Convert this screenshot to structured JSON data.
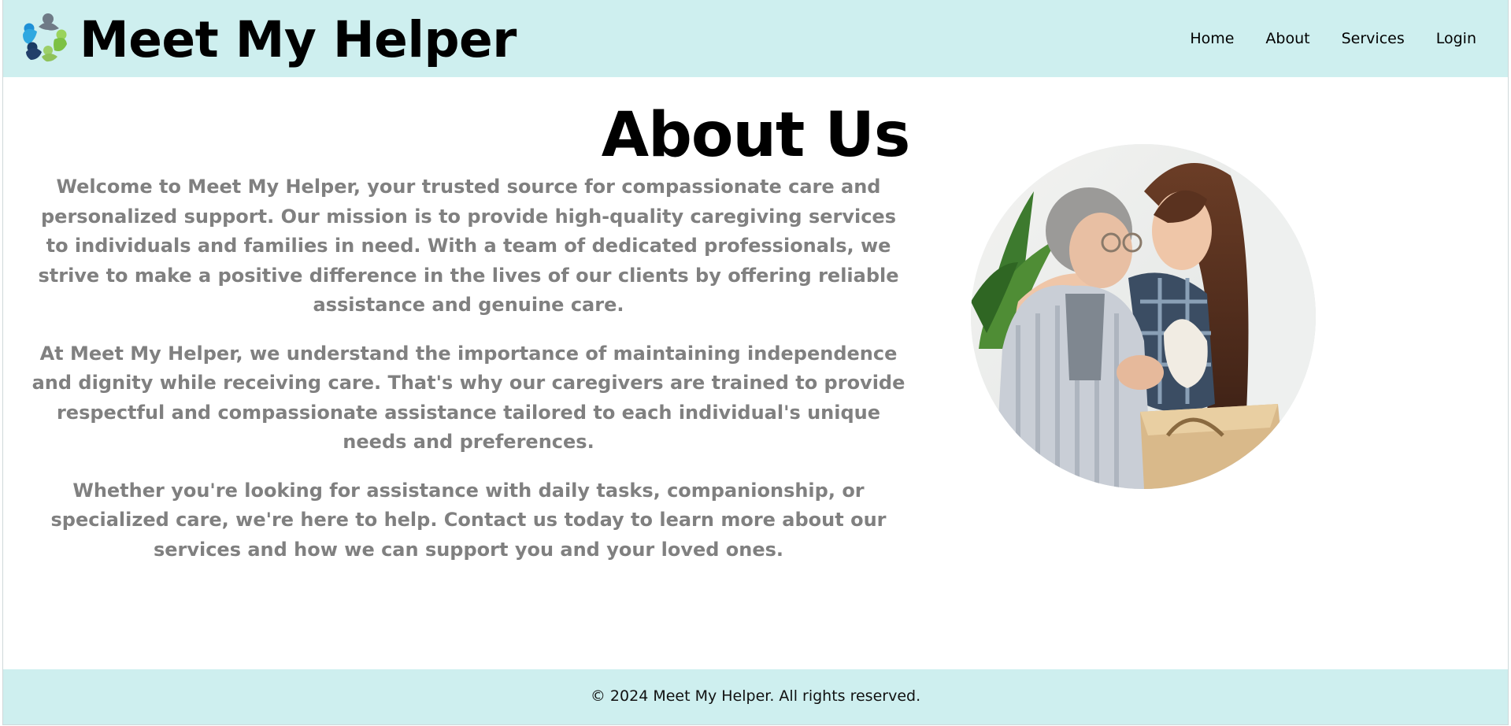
{
  "header": {
    "site_title": "Meet My Helper",
    "logo_icon": "people-circle-logo-icon",
    "background": "#ceefef",
    "nav": [
      {
        "label": "Home"
      },
      {
        "label": "About"
      },
      {
        "label": "Services"
      },
      {
        "label": "Login"
      }
    ]
  },
  "main": {
    "heading": "About Us",
    "text_color": "#808080",
    "paragraphs": [
      "Welcome to Meet My Helper, your trusted source for compassionate care and personalized support. Our mission is to provide high-quality caregiving services to individuals and families in need. With a team of dedicated professionals, we strive to make a positive difference in the lives of our clients by offering reliable assistance and genuine care.",
      "At Meet My Helper, we understand the importance of maintaining independence and dignity while receiving care. That's why our caregivers are trained to provide respectful and compassionate assistance tailored to each individual's unique needs and preferences.",
      "Whether you're looking for assistance with daily tasks, companionship, or specialized care, we're here to help. Contact us today to learn more about our services and how we can support you and your loved ones."
    ],
    "photo_icon": "caregiver-with-elderly-woman-photo"
  },
  "footer": {
    "copyright": "© 2024 Meet My Helper. All rights reserved."
  }
}
